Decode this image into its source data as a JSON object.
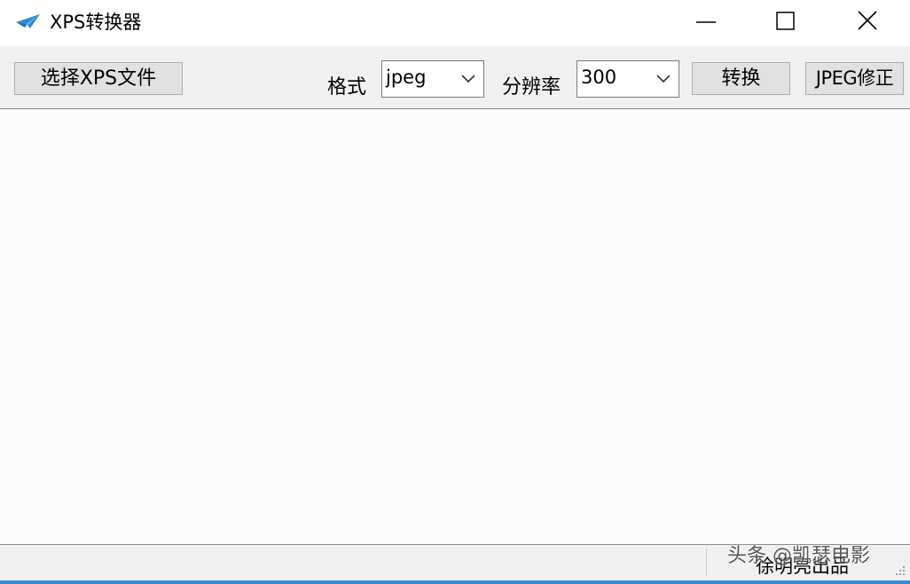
{
  "window": {
    "title": "XPS转换器",
    "app_icon": "paper-plane-icon",
    "controls": {
      "minimize_icon": "minimize-icon",
      "maximize_icon": "maximize-icon",
      "close_icon": "close-icon"
    }
  },
  "toolbar": {
    "select_file_label": "选择XPS文件",
    "format_label": "格式",
    "format_value": "jpeg",
    "resolution_label": "分辨率",
    "resolution_value": "300",
    "convert_label": "转换",
    "jpeg_fix_label": "JPEG修正"
  },
  "statusbar": {
    "text": "徐明亮出品"
  },
  "watermark": {
    "text": "头条 @凯瑟电影"
  },
  "colors": {
    "titlebar_bg": "#ffffff",
    "window_bg": "#f0f0f0",
    "button_bg": "#e1e1e1",
    "icon_blue": "#2e8bd6",
    "bottom_accent": "#3b88d8"
  }
}
